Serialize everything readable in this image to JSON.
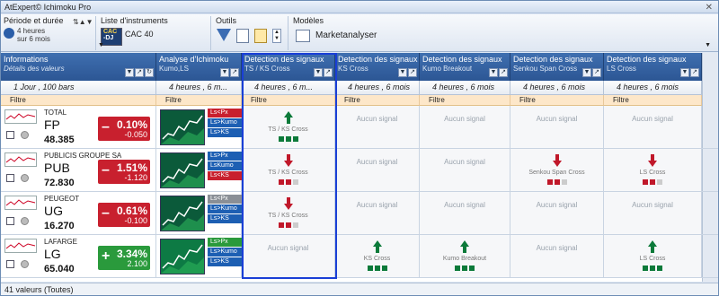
{
  "app_title": "AtExpert© Ichimoku Pro",
  "toolbar": {
    "period_label": "Période et durée",
    "period_value": "4 heures",
    "period_duration": "sur 6 mois",
    "instruments_label": "Liste d'instruments",
    "instrument_badge_top": "CAC",
    "instrument_badge_bottom": "-DJ",
    "instrument_value": "CAC 40",
    "tools_label": "Outils",
    "models_label": "Modèles",
    "model_value": "Marketanalyser"
  },
  "columns": [
    {
      "title": "Informations",
      "sub": "Détails des valeurs",
      "setting": "1 Jour , 100 bars",
      "filter": "Filtre"
    },
    {
      "title": "Analyse d'Ichimoku",
      "sub": "Kumo,LS",
      "setting": "4 heures , 6 m...",
      "filter": "Filtre"
    },
    {
      "title": "Detection des signaux",
      "sub": "TS / KS Cross",
      "setting": "4 heures , 6 m...",
      "filter": "Filtre"
    },
    {
      "title": "Detection des signaux",
      "sub": "KS Cross",
      "setting": "4 heures , 6 mois",
      "filter": "Filtre"
    },
    {
      "title": "Detection des signaux",
      "sub": "Kumo Breakout",
      "setting": "4 heures , 6 mois",
      "filter": "Filtre"
    },
    {
      "title": "Detection des signaux",
      "sub": "Senkou Span Cross",
      "setting": "4 heures , 6 mois",
      "filter": "Filtre"
    },
    {
      "title": "Detection des signaux",
      "sub": "LS Cross",
      "setting": "4 heures , 6 mois",
      "filter": "Filtre"
    }
  ],
  "rows": [
    {
      "name": "TOTAL",
      "ticker": "FP",
      "last": "48.385",
      "pct": "0.10%",
      "chg": "-0.050",
      "sign": "–",
      "color": "#c8202e",
      "tags": [
        "Ls<Px",
        "Ls>Kumo",
        "Ls>KS"
      ],
      "tag_colors": [
        "#c8202e",
        "#1d5fb3",
        "#1d5fb3"
      ],
      "signals": [
        {
          "kind": "up",
          "label": "TS / KS Cross"
        },
        {
          "kind": "none",
          "label": "Aucun signal"
        },
        {
          "kind": "none",
          "label": "Aucun signal"
        },
        {
          "kind": "none",
          "label": "Aucun signal"
        },
        {
          "kind": "none",
          "label": "Aucun signal"
        }
      ]
    },
    {
      "name": "PUBLICIS GROUPE SA",
      "ticker": "PUB",
      "last": "72.830",
      "pct": "1.51%",
      "chg": "-1.120",
      "sign": "–",
      "color": "#c8202e",
      "tags": [
        "Ls>Px",
        "LsKumo",
        "Ls<KS"
      ],
      "tag_colors": [
        "#1d5fb3",
        "#1d5fb3",
        "#c8202e"
      ],
      "signals": [
        {
          "kind": "down",
          "label": "TS / KS Cross"
        },
        {
          "kind": "none",
          "label": "Aucun signal"
        },
        {
          "kind": "none",
          "label": "Aucun signal"
        },
        {
          "kind": "down",
          "label": "Senkou Span Cross"
        },
        {
          "kind": "down",
          "label": "LS Cross"
        }
      ]
    },
    {
      "name": "PEUGEOT",
      "ticker": "UG",
      "last": "16.270",
      "pct": "0.61%",
      "chg": "-0.100",
      "sign": "–",
      "color": "#c8202e",
      "tags": [
        "Ls<Px",
        "Ls>Kumo",
        "Ls>KS"
      ],
      "tag_colors": [
        "#8a8f96",
        "#1d5fb3",
        "#1d5fb3"
      ],
      "signals": [
        {
          "kind": "down",
          "label": "TS / KS Cross"
        },
        {
          "kind": "none",
          "label": "Aucun signal"
        },
        {
          "kind": "none",
          "label": "Aucun signal"
        },
        {
          "kind": "none",
          "label": "Aucun signal"
        },
        {
          "kind": "none",
          "label": "Aucun signal"
        }
      ]
    },
    {
      "name": "LAFARGE",
      "ticker": "LG",
      "last": "65.040",
      "pct": "3.34%",
      "chg": "2.100",
      "sign": "+",
      "color": "#2a9a3c",
      "tags": [
        "Ls>Px",
        "Ls>Kumo",
        "Ls>KS"
      ],
      "tag_colors": [
        "#2a9a3c",
        "#1d5fb3",
        "#1d5fb3"
      ],
      "signals": [
        {
          "kind": "none",
          "label": "Aucun signal"
        },
        {
          "kind": "up",
          "label": "KS Cross"
        },
        {
          "kind": "up",
          "label": "Kumo Breakout"
        },
        {
          "kind": "none",
          "label": "Aucun signal"
        },
        {
          "kind": "up",
          "label": "LS Cross"
        }
      ]
    }
  ],
  "status": "41 valeurs (Toutes)"
}
